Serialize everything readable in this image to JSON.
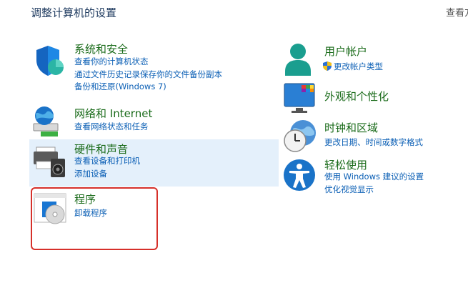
{
  "header": {
    "title": "调整计算机的设置",
    "view_by": "查看方"
  },
  "categories_left": [
    {
      "title": "系统和安全",
      "icon": "shield-icon",
      "links": [
        "查看你的计算机状态",
        "通过文件历史记录保存你的文件备份副本",
        "备份和还原(Windows 7)"
      ]
    },
    {
      "title": "网络和 Internet",
      "icon": "network-globe-icon",
      "links": [
        "查看网络状态和任务"
      ]
    },
    {
      "title": "硬件和声音",
      "icon": "printer-speaker-icon",
      "links": [
        "查看设备和打印机",
        "添加设备"
      ]
    },
    {
      "title": "程序",
      "icon": "programs-disc-icon",
      "links": [
        "卸载程序"
      ]
    }
  ],
  "categories_right": [
    {
      "title": "用户帐户",
      "icon": "user-accounts-icon",
      "links": [
        "更改帐户类型"
      ]
    },
    {
      "title": "外观和个性化",
      "icon": "monitor-palette-icon",
      "links": []
    },
    {
      "title": "时钟和区域",
      "icon": "clock-globe-icon",
      "links": [
        "更改日期、时间或数字格式"
      ]
    },
    {
      "title": "轻松使用",
      "icon": "accessibility-icon",
      "links": [
        "使用 Windows 建议的设置",
        "优化视觉显示"
      ]
    }
  ]
}
